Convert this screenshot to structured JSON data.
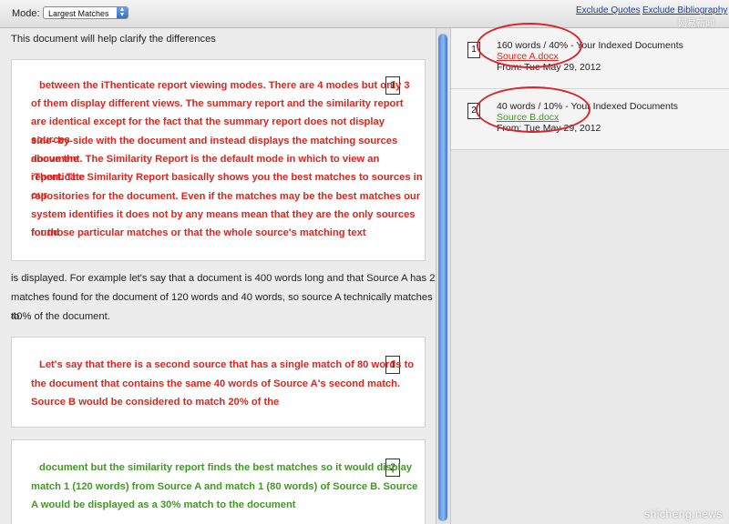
{
  "toolbar": {
    "mode_label": "Mode:",
    "mode_value": "Largest Matches",
    "exclude_quotes": "Exclude Quotes",
    "exclude_bibliography": "Exclude Bibliography",
    "watermark": "网易新闻"
  },
  "document": {
    "intro": "This document will help clarify the differences",
    "match1_number": "1",
    "match1_lines": [
      "between the iThenticate report viewing modes. There are 4 modes but only 3",
      "of them display different views. The summary report and the similarity report",
      "are identical except for the fact that the summary report does not display sources",
      "side- by-side with the document and instead displays the matching sources above the",
      "document. The Similarity Report is the default mode in which to view an iThenticate",
      "report. The Similarity Report basically shows you the best matches to sources in our",
      "repositories for the document. Even if the matches may be the best matches our",
      "system identifies it does not by any means mean that they are the only sources found",
      "for those particular matches or that the whole source's matching text"
    ],
    "mid_lines": [
      "is displayed. For example let's say that a document is 400 words long and that Source A has 2",
      "matches found for the document of 120 words and 40 words, so source A technically matches to",
      "40% of the document."
    ],
    "match2_number": "1",
    "match2_lines": [
      "Let's say that there is a second source that has a single match of 80 words to",
      "the document that contains the same 40 words of Source A's second match.",
      "Source B would be considered to match 20% of the"
    ],
    "match3_number": "2",
    "match3_lines": [
      "document but the similarity report finds the best matches so it would display",
      "match 1 (120 words) from Source A and match 1 (80 words) of Source B. Source",
      "A would be displayed as a 30% match to the document"
    ]
  },
  "sources": [
    {
      "number": "1",
      "summary": "160 words / 40% - Your Indexed Documents",
      "name": "Source A.docx",
      "date": "From: Tue May 29, 2012",
      "color": "#e0241c"
    },
    {
      "number": "2",
      "summary": "40 words / 10% - Your Indexed Documents",
      "name": "Source B.docx",
      "date": "From: Tue May 29, 2012",
      "color": "#3f9a22"
    }
  ],
  "footer": {
    "watermark": "shicheng.news"
  }
}
